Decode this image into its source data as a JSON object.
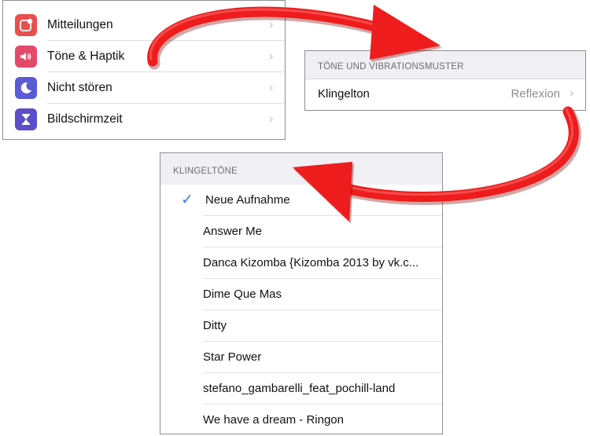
{
  "settings": {
    "items": [
      {
        "label": "Mitteilungen",
        "icon": "notifications-icon",
        "color": "#e9504d"
      },
      {
        "label": "Töne & Haptik",
        "icon": "speaker-icon",
        "color": "#e34a6a"
      },
      {
        "label": "Nicht stören",
        "icon": "moon-icon",
        "color": "#5b5bd6"
      },
      {
        "label": "Bildschirmzeit",
        "icon": "hourglass-icon",
        "color": "#5b4fc7"
      }
    ]
  },
  "tones": {
    "header": "TÖNE UND VIBRATIONSMUSTER",
    "ringtone_label": "Klingelton",
    "ringtone_value": "Reflexion"
  },
  "ringtones": {
    "header": "KLINGELTÖNE",
    "selected_index": 0,
    "items": [
      "Neue Aufnahme",
      "Answer Me",
      "Danca Kizomba {Kizomba 2013 by vk.c...",
      "Dime Que Mas",
      "Ditty",
      "Star Power",
      "stefano_gambarelli_feat_pochill-land",
      "We have a dream - Ringon"
    ]
  },
  "colors": {
    "arrow": "#ee1c1c",
    "accent": "#2f7cf6"
  },
  "icons": {
    "chevron": "›",
    "check": "✓"
  }
}
